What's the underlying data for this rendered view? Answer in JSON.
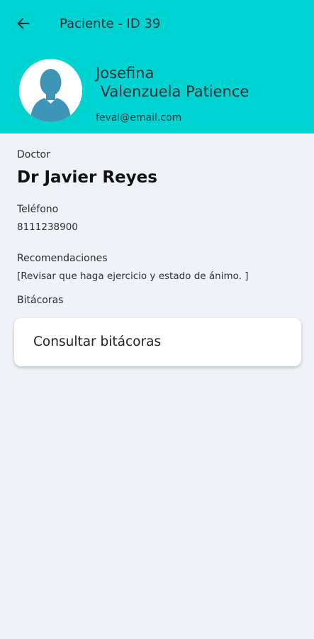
{
  "header": {
    "title": "Paciente - ID 39",
    "back_icon": "arrow-left-icon",
    "avatar_icon": "user-avatar-icon",
    "background_color": "#00d4d2",
    "patient_name": "Josefina\n Valenzuela Patience",
    "patient_email": "feval@email.com"
  },
  "details": {
    "doctor_label": "Doctor",
    "doctor_name": "Dr Javier Reyes",
    "phone_label": "Teléfono",
    "phone_value": "8111238900",
    "recommendations_label": "Recomendaciones",
    "recommendations_value": "[Revisar que haga ejercicio y estado de ánimo. ]",
    "logs_label": "Bitácoras"
  },
  "actions": {
    "consult_logs_label": "Consultar bitácoras"
  }
}
